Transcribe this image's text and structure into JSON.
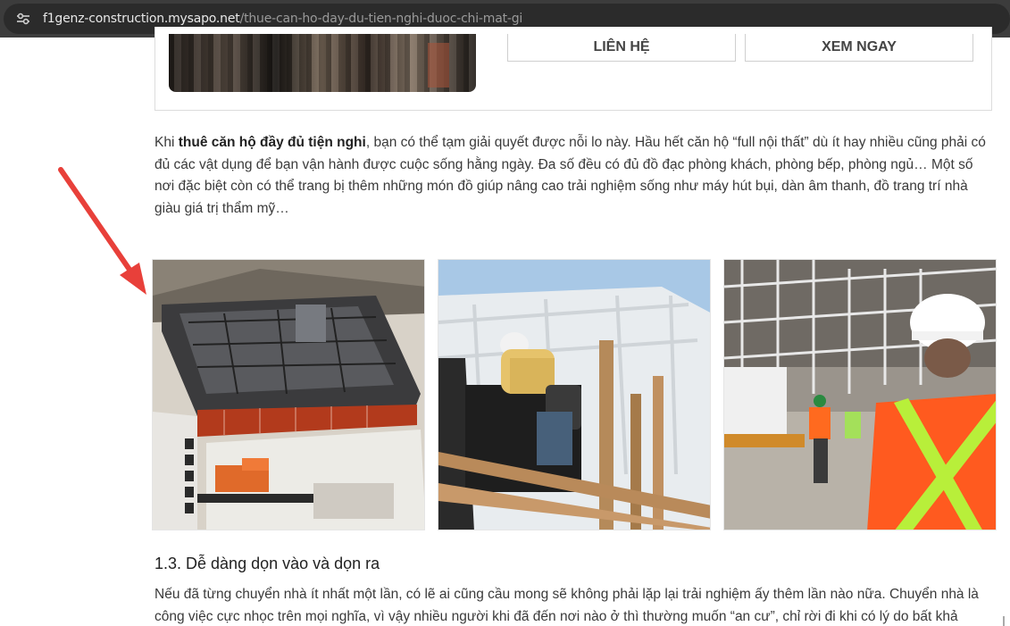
{
  "browser": {
    "url_host": "f1genz-construction.mysapo.net",
    "url_path": "/thue-can-ho-day-du-tien-nghi-duoc-chi-mat-gi"
  },
  "card": {
    "contact_label": "LIÊN HỆ",
    "view_label": "XEM NGAY"
  },
  "article": {
    "para1_lead": "Khi ",
    "para1_bold": "thuê căn hộ đầy đủ tiện nghi",
    "para1_rest": ", bạn có thể tạm giải quyết được nỗi lo này. Hầu hết căn hộ “full nội thất” dù ít hay nhiều cũng phải có đủ các vật dụng để bạn vận hành được cuộc sống hằng ngày. Đa số đều có đủ đồ đạc phòng khách, phòng bếp, phòng ngủ… Một số nơi đặc biệt còn có thể trang bị thêm những món đồ giúp nâng cao trải nghiệm sống như máy hút bụi, dàn âm thanh, đồ trang trí nhà giàu giá trị thẩm mỹ…",
    "heading": "1.3. Dễ dàng dọn vào và dọn ra",
    "para2": "Nếu đã từng chuyển nhà ít nhất một lần, có lẽ ai cũng cầu mong sẽ không phải lặp lại trải nghiệm ấy thêm lần nào nữa. Chuyển nhà là công việc cực nhọc trên mọi nghĩa, vì vậy nhiều người khi đã đến nơi nào ở thì thường muốn “an cư”, chỉ rời đi khi có lý do bất khả"
  },
  "colors": {
    "arrow": "#e8403a",
    "vest_orange": "#ff5a1f",
    "hard_hat": "#ffffff",
    "sky": "#b9d3ea"
  }
}
